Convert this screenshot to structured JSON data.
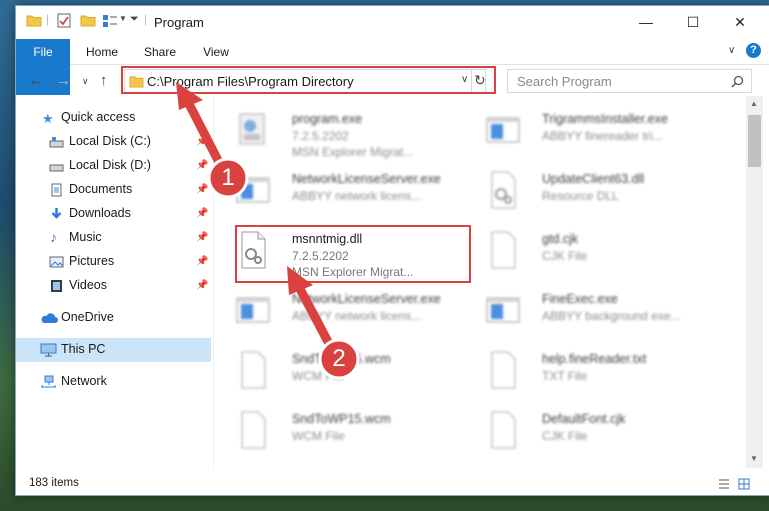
{
  "window": {
    "title": "Program",
    "minimize": "—",
    "maximize": "☐",
    "close": "✕"
  },
  "ribbon": {
    "tabs": [
      "File",
      "Home",
      "Share",
      "View"
    ]
  },
  "address": {
    "path": "C:\\Program Files\\Program Directory",
    "search_placeholder": "Search Program"
  },
  "sidebar": {
    "quick_access": "Quick access",
    "items": [
      {
        "label": "Local Disk (C:)",
        "icon": "drive-icon",
        "pinned": true
      },
      {
        "label": "Local Disk (D:)",
        "icon": "drive-icon",
        "pinned": true
      },
      {
        "label": "Documents",
        "icon": "documents-icon",
        "pinned": true
      },
      {
        "label": "Downloads",
        "icon": "download-icon",
        "pinned": true
      },
      {
        "label": "Music",
        "icon": "music-icon",
        "pinned": true
      },
      {
        "label": "Pictures",
        "icon": "pictures-icon",
        "pinned": true
      },
      {
        "label": "Videos",
        "icon": "videos-icon",
        "pinned": true
      }
    ],
    "onedrive": "OneDrive",
    "thispc": "This PC",
    "network": "Network"
  },
  "files": [
    {
      "name": "program.exe",
      "line2": "7.2.5.2202",
      "line3": "MSN Explorer Migrat...",
      "icon": "exe-icon"
    },
    {
      "name": "TrigrammsInstaller.exe",
      "line2": "ABBYY finereader tri...",
      "line3": "",
      "icon": "window-icon"
    },
    {
      "name": "NetworkLicenseServer.exe",
      "line2": "ABBYY network licens...",
      "line3": "",
      "icon": "window-icon"
    },
    {
      "name": "UpdateClient63.dll",
      "line2": "Resource DLL",
      "line3": "",
      "icon": "dll-icon"
    },
    {
      "name": "msnntmig.dll",
      "line2": "7.2.5.2202",
      "line3": "MSN Explorer Migrat...",
      "icon": "dll-icon"
    },
    {
      "name": "gtd.cjk",
      "line2": "CJK File",
      "line3": "",
      "icon": "blank-file-icon"
    },
    {
      "name": "NetworkLicenseServer.exe",
      "line2": "ABBYY network licens...",
      "line3": "",
      "icon": "window-icon"
    },
    {
      "name": "FineExec.exe",
      "line2": "ABBYY background exe...",
      "line3": "",
      "icon": "window-icon"
    },
    {
      "name": "SndToWP15.wcm",
      "line2": "WCM File",
      "line3": "",
      "icon": "blank-file-icon"
    },
    {
      "name": "help.fineReader.txt",
      "line2": "TXT File",
      "line3": "",
      "icon": "blank-file-icon"
    },
    {
      "name": "SndToWP15.wcm",
      "line2": "WCM File",
      "line3": "",
      "icon": "blank-file-icon"
    },
    {
      "name": "DefaultFont.cjk",
      "line2": "CJK File",
      "line3": "",
      "icon": "blank-file-icon"
    }
  ],
  "status": {
    "count": "183 items"
  },
  "annotations": {
    "step1": "1",
    "step2": "2",
    "color": "#d9423e"
  }
}
